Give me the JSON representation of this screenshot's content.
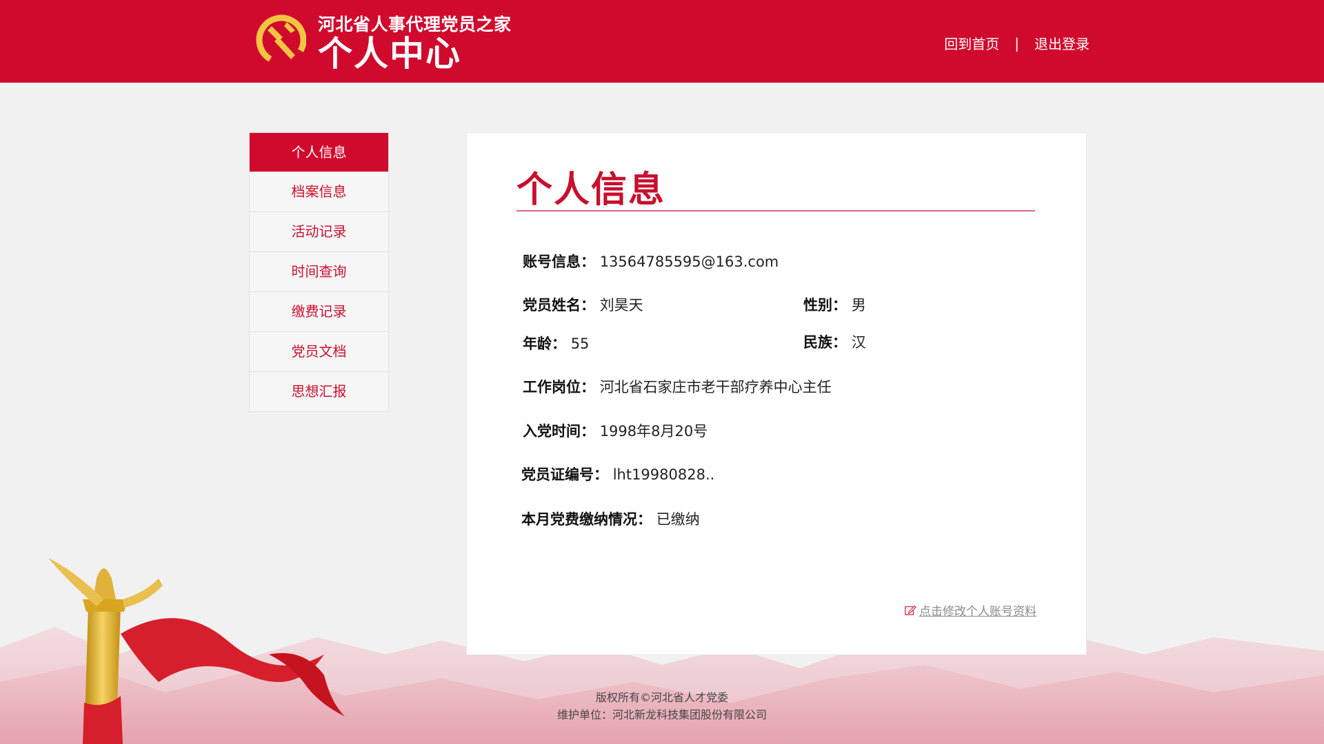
{
  "header": {
    "site_name": "河北省人事代理党员之家",
    "page_title": "个人中心",
    "nav_home": "回到首页",
    "nav_separator": "|",
    "nav_logout": "退出登录",
    "emblem_icon": "party-emblem-icon",
    "brand_color": "#d00a2d"
  },
  "sidebar": {
    "items": [
      {
        "label": "个人信息",
        "active": true
      },
      {
        "label": "档案信息",
        "active": false
      },
      {
        "label": "活动记录",
        "active": false
      },
      {
        "label": "时间查询",
        "active": false
      },
      {
        "label": "缴费记录",
        "active": false
      },
      {
        "label": "党员文档",
        "active": false
      },
      {
        "label": "思想汇报",
        "active": false
      }
    ]
  },
  "profile": {
    "title": "个人信息",
    "account_label": "账号信息：",
    "account_value": "13564785595@163.com",
    "name_label": "党员姓名：",
    "name_value": "刘昊天",
    "gender_label": "性别：",
    "gender_value": "男",
    "age_label": "年龄：",
    "age_value": "55",
    "ethnicity_label": "民族：",
    "ethnicity_value": "汉",
    "job_label": "工作岗位：",
    "job_value": "河北省石家庄市老干部疗养中心主任",
    "join_label": "入党时间：",
    "join_value": "1998年8月20号",
    "card_label": "党员证编号：",
    "card_value": "lht19980828..",
    "fee_label": "本月党费缴纳情况：",
    "fee_value": "已缴纳",
    "edit_link": "点击修改个人账号资料",
    "edit_icon": "edit-icon"
  },
  "footer": {
    "copyright": "版权所有©河北省人才党委",
    "maintainer": "维护单位：河北新龙科技集团股份有限公司"
  }
}
